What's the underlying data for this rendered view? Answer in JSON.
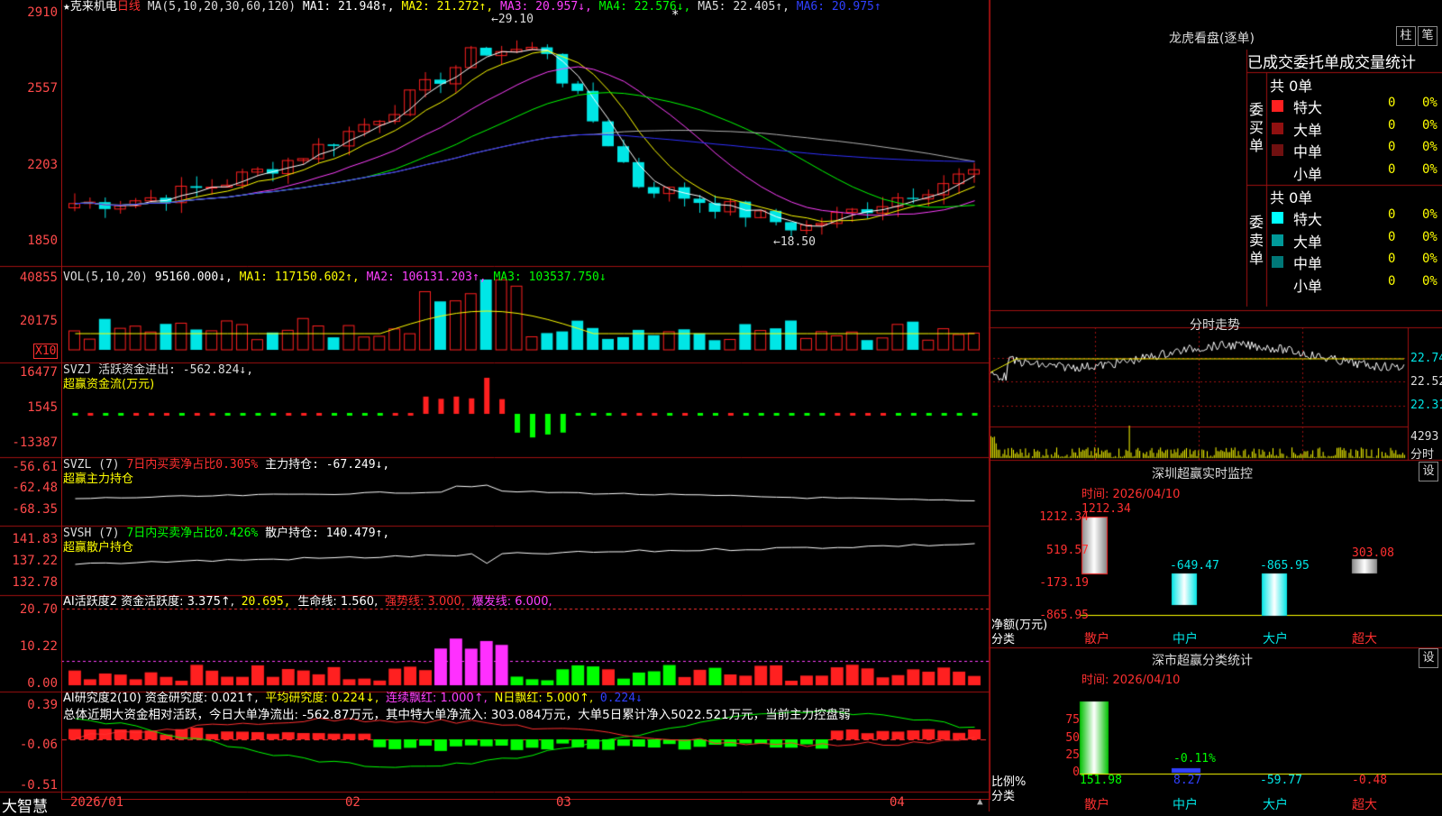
{
  "header": {
    "title_star": "★",
    "stock_name": "克来机电",
    "period": "日线",
    "ma_label": "MA(5,10,20,30,60,120)",
    "ma1": "MA1: 21.948↑,",
    "ma2": "MA2: 21.272↑,",
    "ma3": "MA3: 20.957↓,",
    "ma4": "MA4: 22.576↓,",
    "ma5": "MA5: 22.405↑,",
    "ma6": "MA6: 20.975↑"
  },
  "price_axis": [
    "2910",
    "2557",
    "2203",
    "1850"
  ],
  "price_labels": {
    "high": "29.10",
    "low": "18.50",
    "marker": "*"
  },
  "vol": {
    "label": "VOL(5,10,20)",
    "v": "95160.000↓,",
    "ma1": "MA1: 117150.602↑,",
    "ma2": "MA2: 106131.203↑,",
    "ma3": "MA3: 103537.750↓",
    "axis": [
      "40855",
      "20175"
    ],
    "unit": "X10"
  },
  "svzj": {
    "line1": "SVZJ  活跃资金进出: -562.824↓,",
    "line2": "超赢资金流(万元)",
    "axis": [
      "16477",
      "1545",
      "-13387"
    ]
  },
  "svzl": {
    "p1": "SVZL (7)",
    "p2": "7日内买卖净占比0.305%",
    "p3": "主力持仓: -67.249↓,",
    "line2": "超赢主力持仓",
    "axis": [
      "-56.61",
      "-62.48",
      "-68.35"
    ]
  },
  "svsh": {
    "p1": "SVSH (7)",
    "p2": "7日内买卖净占比0.426%",
    "p3": "散户持仓: 140.479↑,",
    "line2": "超赢散户持仓",
    "axis": [
      "141.83",
      "137.22",
      "132.78"
    ]
  },
  "ai1": {
    "p1": "AI活跃度2 资金活跃度: 3.375↑,",
    "p2": "20.695,",
    "p3": "生命线: 1.560,",
    "p4": "强势线: 3.000,",
    "p5": "爆发线: 6.000,",
    "axis": [
      "20.70",
      "10.22",
      "0.00"
    ]
  },
  "ai2": {
    "p1": "AI研究度2(10) 资金研究度: 0.021↑,",
    "p2": "平均研究度: 0.224↓,",
    "p3": "连续飘红: 1.000↑,",
    "p4": "N日飘红: 5.000↑,",
    "p5": "0.224↓",
    "summary": "总体近期大资金相对活跃，今日大单净流出: -562.87万元，其中特大单净流入: 303.084万元，大单5日累计净入5022.521万元，当前主力控盘弱",
    "axis": [
      "0.39",
      "-0.06",
      "-0.51"
    ]
  },
  "dates": [
    "2026/01",
    "02",
    "03",
    "04"
  ],
  "logo": "大智慧",
  "right": {
    "lhkp_title": "龙虎看盘(逐单)",
    "btn_zhu": "柱",
    "btn_bi": "笔",
    "table_title": "已成交委托单成交量统计",
    "buy_label": "委买单",
    "sell_label": "委卖单",
    "buy_total": "共 0单",
    "sell_total": "共 0单",
    "rows": [
      {
        "name": "特大",
        "qty": "0",
        "pct": "0%"
      },
      {
        "name": "大单",
        "qty": "0",
        "pct": "0%"
      },
      {
        "name": "中单",
        "qty": "0",
        "pct": "0%"
      },
      {
        "name": "小单",
        "qty": "0",
        "pct": "0%"
      }
    ],
    "sell_rows": [
      {
        "name": "特大",
        "qty": "0",
        "pct": "0%"
      },
      {
        "name": "大单",
        "qty": "0",
        "pct": "0%"
      },
      {
        "name": "中单",
        "qty": "0",
        "pct": "0%"
      },
      {
        "name": "小单",
        "qty": "0",
        "pct": "0%"
      }
    ],
    "fs_title": "分时走势",
    "fs_axis": [
      "22.74",
      "22.52",
      "22.31",
      "4293"
    ],
    "fs_unit": "分时",
    "sz_title": "深圳超赢实时监控",
    "sz_time": "时间: 2026/04/10",
    "sz_btn": "设",
    "sz_axis": [
      "1212.34",
      "519.57",
      "-173.19",
      "-865.95"
    ],
    "sz_values": [
      "1212.34",
      "-649.47",
      "-865.95",
      "303.08"
    ],
    "sz_unit1": "净额(万元)",
    "sz_unit2": "分类",
    "cats": [
      "散户",
      "中户",
      "大户",
      "超大"
    ],
    "sc_title": "深市超赢分类统计",
    "sc_time": "时间: 2026/04/10",
    "sc_btn": "设",
    "sc_axis": [
      "75",
      "50",
      "25",
      "0"
    ],
    "sc_pct": "-0.11%",
    "sc_unit1": "比例%",
    "sc_unit2": "分类",
    "sc_values": [
      "151.98",
      "8.27",
      "-59.77",
      "-0.48"
    ]
  },
  "colors": {
    "up": "#ff2020",
    "down": "#00e6e6",
    "grid": "#a01010",
    "ma1": "#ffffff",
    "ma2": "#ffff00",
    "ma3": "#ff40ff",
    "ma4": "#00ff00",
    "ma5": "#b0b0b0",
    "ma6": "#3030ff"
  }
}
